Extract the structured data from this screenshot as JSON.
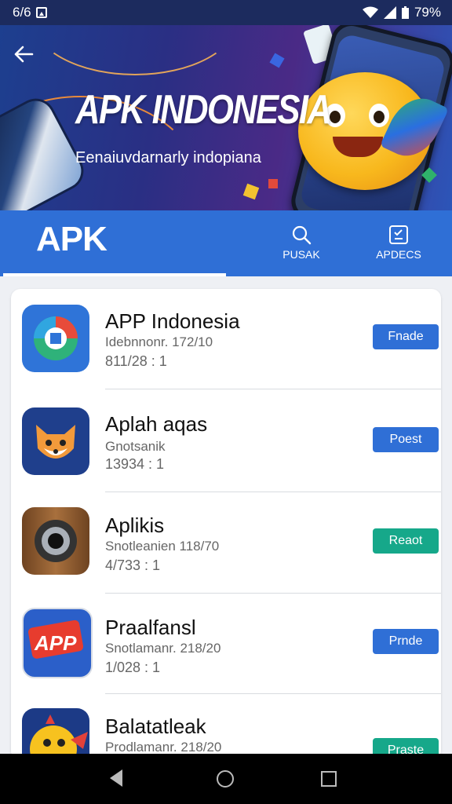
{
  "status_bar": {
    "time": "6/6",
    "battery": "79%"
  },
  "banner": {
    "title": "APK INDONESIA",
    "subtitle": "Eenaiuvdarnarly indopiana"
  },
  "tabs": {
    "brand": "APK",
    "items": [
      {
        "label": "PUSAK",
        "icon": "search-icon"
      },
      {
        "label": "APDECS",
        "icon": "checklist-icon"
      }
    ]
  },
  "apps": [
    {
      "title": "APP Indonesia",
      "meta1": "Idebnnonr. 172/10",
      "meta2": "811/28 : 1",
      "button": "Fnade",
      "button_color": "#2f6fd6",
      "icon": "globe-app-icon"
    },
    {
      "title": "Aplah aqas",
      "meta1": "Gnotsanik",
      "meta2": "13934 : 1",
      "button": "Poest",
      "button_color": "#2f6fd6",
      "icon": "fox-app-icon"
    },
    {
      "title": "Aplikis",
      "meta1": "Snotleanien 118/70",
      "meta2": "4/733 : 1",
      "button": "Reaot",
      "button_color": "#16a88a",
      "icon": "camera-app-icon"
    },
    {
      "title": "Praalfansl",
      "meta1": "Snotlamanr. 218/20",
      "meta2": "1/028 : 1",
      "button": "Prnde",
      "button_color": "#2f6fd6",
      "icon": "app-logo-icon"
    },
    {
      "title": "Balatatleak",
      "meta1": "Prodlamanr. 218/20",
      "meta2": "",
      "button": "Praste",
      "button_color": "#16a88a",
      "icon": "duck-app-icon"
    }
  ]
}
